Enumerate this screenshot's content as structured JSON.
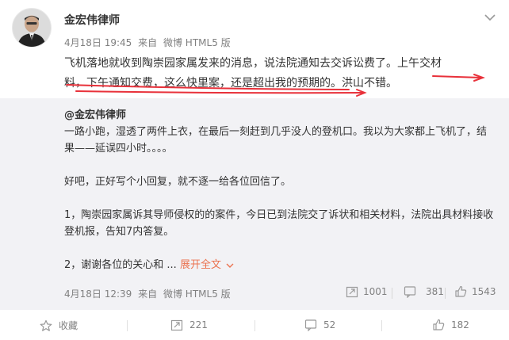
{
  "post": {
    "author": "金宏伟律师",
    "date": "4月18日 19:45",
    "source_prefix": "来自",
    "source": "微博 HTML5 版",
    "text_line1": "飞机落地就收到陶崇园家属发来的消息，说法院通知去交诉讼费了。上午交材",
    "text_line2": "料，下午通知交费，这么快里案，还是超出我的预期的。洪山不错。"
  },
  "repost": {
    "author": "@金宏伟律师",
    "body": [
      "一路小跑，湿透了两件上衣，在最后一刻赶到几乎没人的登机口。我以为大家都上飞机了，结",
      "果——延误四小时。。。。",
      "",
      "好吧，正好写个小回复，就不逐一给各位回信了。",
      "",
      "1，陶崇园家属诉其导师侵权的的案件，今日已到法院交了诉状和相关材料，法院出具材料接收",
      "登机报，告知7内答复。",
      ""
    ],
    "last_line": "2，谢谢各位的关心和 ...",
    "expand_label": "展开全文",
    "date": "4月18日 12:39",
    "source_prefix": "来自",
    "source": "微博 HTML5 版",
    "forward_count": "1001",
    "comment_count": "381",
    "like_count": "1543"
  },
  "actions": {
    "favorite_label": "收藏",
    "forward_count": "221",
    "comment_count": "52",
    "like_count": "182"
  },
  "colors": {
    "accent": "#eb7350",
    "annotation": "#e8313a",
    "repost_bg": "#f2f2f5",
    "meta_text": "#808080"
  },
  "icons": [
    "more-icon",
    "forward-icon",
    "comment-icon",
    "like-icon",
    "star-icon",
    "chevron-down-icon"
  ]
}
